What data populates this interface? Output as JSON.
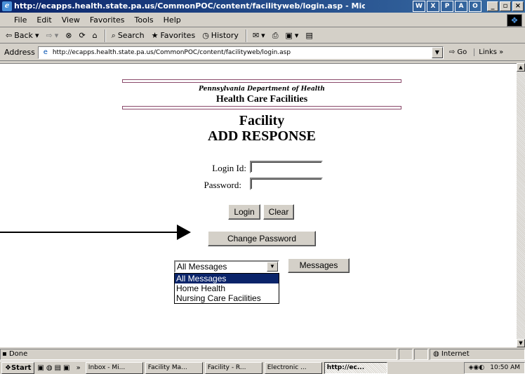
{
  "window": {
    "title": "http://ecapps.health.state.pa.us/CommonPOC/content/facilityweb/login.asp - Microsoft Internet Explorer",
    "minimize": "_",
    "maximize": "▫",
    "close": "×"
  },
  "menubar": {
    "items": [
      "File",
      "Edit",
      "View",
      "Favorites",
      "Tools",
      "Help"
    ]
  },
  "toolbar": {
    "back": "Back",
    "search": "Search",
    "favorites": "Favorites",
    "history": "History"
  },
  "address": {
    "label": "Address",
    "url": "http://ecapps.health.state.pa.us/CommonPOC/content/facilityweb/login.asp",
    "go": "Go",
    "links": "Links »"
  },
  "page": {
    "agency": "Pennsylvania Department of Health",
    "section": "Health Care Facilities",
    "title_line1": "Facility",
    "title_line2": "ADD RESPONSE",
    "login_label": "Login Id:",
    "password_label": "Password:",
    "login_button": "Login",
    "clear_button": "Clear",
    "change_password_button": "Change Password",
    "messages_select": {
      "selected": "All Messages",
      "options": [
        "All Messages",
        "Home Health",
        "Nursing Care Facilities"
      ]
    },
    "messages_button": "Messages"
  },
  "statusbar": {
    "text": "Done",
    "zone": "Internet"
  },
  "taskbar": {
    "start": "Start",
    "tasks": [
      "Inbox - Mi...",
      "Facility Ma...",
      "Facility - R...",
      "Electronic ...",
      "http://ec..."
    ],
    "clock": "10:50 AM"
  }
}
